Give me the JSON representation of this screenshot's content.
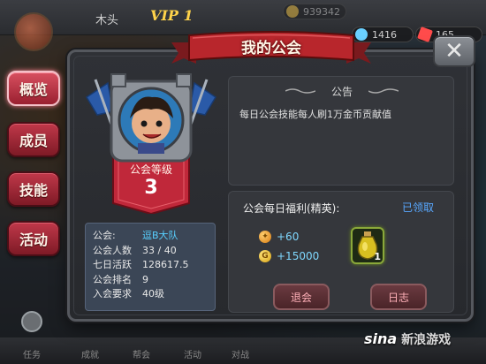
{
  "header": {
    "player_name": "木头",
    "vip": "VIP 1",
    "resources": {
      "gold": "939342",
      "gems": "1416",
      "energy": "165"
    }
  },
  "dialog": {
    "title": "我的公会",
    "close": "✕"
  },
  "tabs": [
    {
      "label": "概览",
      "active": true
    },
    {
      "label": "成员",
      "active": false
    },
    {
      "label": "技能",
      "active": false
    },
    {
      "label": "活动",
      "active": false
    }
  ],
  "guild": {
    "level_label": "公会等级",
    "level": "3",
    "info": [
      {
        "key": "公会:",
        "value": "逗B大队"
      },
      {
        "key": "公会人数",
        "value": "33 / 40"
      },
      {
        "key": "七日活跃",
        "value": "128617.5"
      },
      {
        "key": "公会排名",
        "value": "9"
      },
      {
        "key": "入会要求",
        "value": "40级"
      }
    ]
  },
  "notice": {
    "title": "公告",
    "body": "每日公会技能每人刷1万金币贡献值"
  },
  "welfare": {
    "title": "公会每日福利(精英):",
    "status": "已领取",
    "rewards": [
      {
        "icon": "contribution-coin-icon",
        "value": "+60"
      },
      {
        "icon": "gold-coin-icon",
        "value": "+15000"
      }
    ],
    "item_count": "1"
  },
  "buttons": {
    "quit": "退会",
    "log": "日志"
  },
  "bottom_nav": [
    "任务",
    "成就",
    "帮会",
    "活动",
    "对战"
  ],
  "watermark": {
    "brand": "sina",
    "text": "新浪游戏"
  },
  "colors": {
    "tab_red": "#c0384a",
    "guild_name": "#58d0ff",
    "claimed": "#58a8ff",
    "reward_value": "#7fd8ff"
  }
}
